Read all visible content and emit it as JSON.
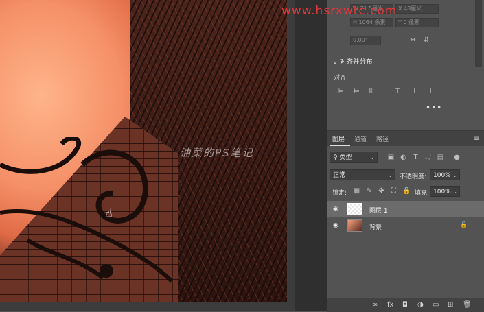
{
  "watermark_url": "www.hsrxwtc.com",
  "canvas_watermark": "油菜的PS笔记",
  "properties": {
    "fields": [
      "W 71.5厘米",
      "X 48厘米",
      "H 1064 像素",
      "Y 0 像素",
      "0.00°"
    ],
    "section_title": "对齐并分布",
    "align_label": "对齐:",
    "more": "•••"
  },
  "layers_panel": {
    "tabs": [
      {
        "label": "图层",
        "active": true
      },
      {
        "label": "通道",
        "active": false
      },
      {
        "label": "路径",
        "active": false
      }
    ],
    "filter_kind": "类型",
    "blend_mode": "正常",
    "opacity_label": "不透明度:",
    "opacity_value": "100%",
    "lock_label": "锁定:",
    "fill_label": "填充:",
    "fill_value": "100%",
    "layers": [
      {
        "name": "图层 1",
        "selected": true,
        "locked": false,
        "thumb": "transparent"
      },
      {
        "name": "背景",
        "selected": false,
        "locked": true,
        "thumb": "photo"
      }
    ]
  },
  "colors": {
    "panel_bg": "#535353",
    "selected_row": "#6b6b6b",
    "watermark_red": "#e2383a"
  }
}
